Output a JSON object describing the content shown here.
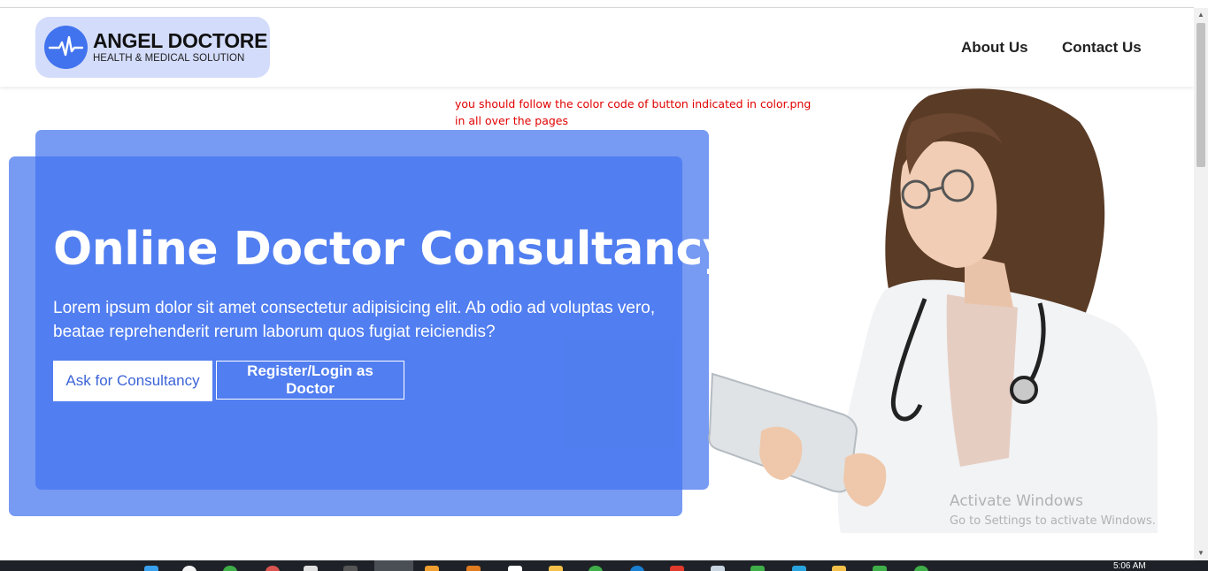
{
  "navbar": {
    "logo_title": "ANGEL DOCTORE",
    "logo_subtitle": "HEALTH & MEDICAL SOLUTION",
    "links": [
      "About Us",
      "Contact Us"
    ]
  },
  "note": {
    "line1": "you should follow the color code of button indicated in color.png",
    "line2": "in all over the pages"
  },
  "hero": {
    "title": "Online Doctor Consultancy",
    "text": "Lorem ipsum dolor sit amet consectetur adipisicing elit. Ab odio ad voluptas vero, beatae reprehenderit rerum laborum quos fugiat reiciendis?",
    "primary_button": "Ask for Consultancy",
    "secondary_button": "Register/Login as Doctor"
  },
  "watermark": {
    "title": "Activate Windows",
    "subtitle": "Go to Settings to activate Windows."
  },
  "taskbar": {
    "clock": "5:06 AM"
  },
  "colors": {
    "accent": "#4273ee",
    "logo_bg": "#d3dcfb",
    "note": "#e00000"
  }
}
